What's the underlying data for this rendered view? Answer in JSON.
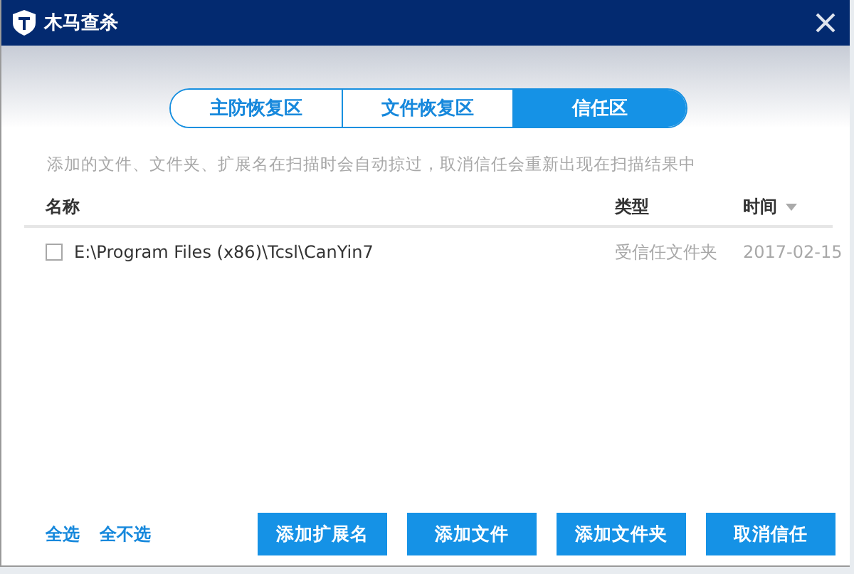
{
  "window": {
    "title": "木马查杀"
  },
  "tabs": [
    {
      "label": "主防恢复区",
      "selected": false
    },
    {
      "label": "文件恢复区",
      "selected": false
    },
    {
      "label": "信任区",
      "selected": true
    }
  ],
  "hint": "添加的文件、文件夹、扩展名在扫描时会自动掠过，取消信任会重新出现在扫描结果中",
  "table": {
    "columns": [
      "名称",
      "类型",
      "时间"
    ],
    "rows": [
      {
        "name": "E:\\Program Files (x86)\\Tcsl\\CanYin7",
        "type": "受信任文件夹",
        "time": "2017-02-15",
        "checked": false
      }
    ]
  },
  "links": [
    "全选",
    "全不选"
  ],
  "buttons": [
    "添加扩展名",
    "添加文件",
    "添加文件夹",
    "取消信任"
  ]
}
